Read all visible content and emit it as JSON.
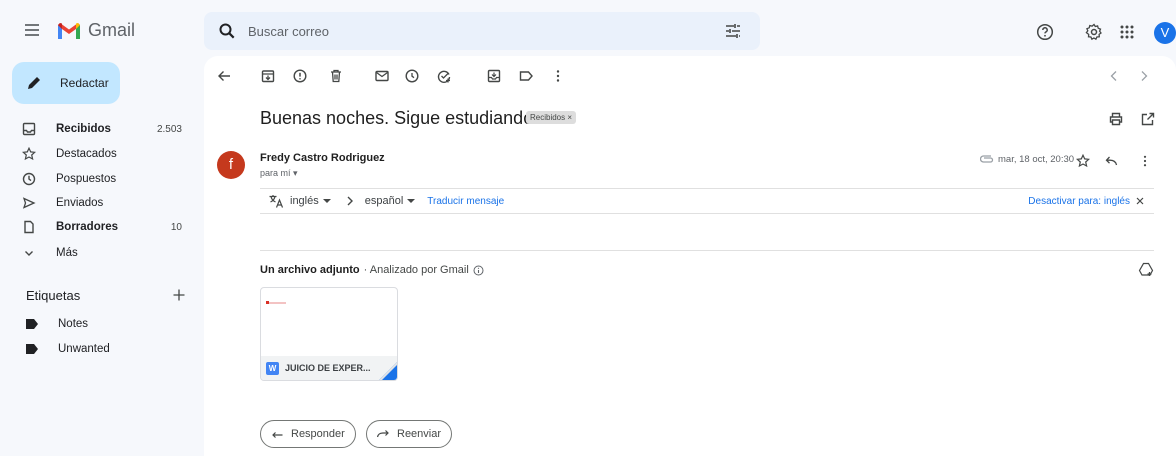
{
  "app": {
    "name": "Gmail"
  },
  "search": {
    "placeholder": "Buscar correo"
  },
  "account": {
    "initial": "V",
    "color": "#1a73e8"
  },
  "sidebar": {
    "compose_label": "Redactar",
    "items": [
      {
        "label": "Recibidos",
        "count": "2.503",
        "bold": true
      },
      {
        "label": "Destacados",
        "count": ""
      },
      {
        "label": "Pospuestos",
        "count": ""
      },
      {
        "label": "Enviados",
        "count": ""
      },
      {
        "label": "Borradores",
        "count": "10",
        "bold": true
      },
      {
        "label": "Más",
        "count": ""
      }
    ],
    "labels_title": "Etiquetas",
    "labels": [
      {
        "label": "Notes"
      },
      {
        "label": "Unwanted"
      }
    ]
  },
  "email": {
    "subject": "Buenas noches. Sigue estudiando.",
    "label_chip": "Recibidos ×",
    "sender": {
      "name": "Fredy Castro Rodriguez",
      "initial": "f",
      "avatar_color": "#c5391d"
    },
    "to": "para mí ▾",
    "date": "mar, 18 oct, 20:30",
    "translation": {
      "from_lang": "inglés",
      "to_lang": "español",
      "translate_link": "Traducir mensaje",
      "disable_link": "Desactivar para: inglés"
    },
    "attachments": {
      "title": "Un archivo adjunto",
      "scanned": "· Analizado por Gmail",
      "file_name": "JUICIO DE EXPER...",
      "file_type_badge": "W"
    },
    "actions": {
      "reply": "Responder",
      "forward": "Reenviar"
    }
  }
}
